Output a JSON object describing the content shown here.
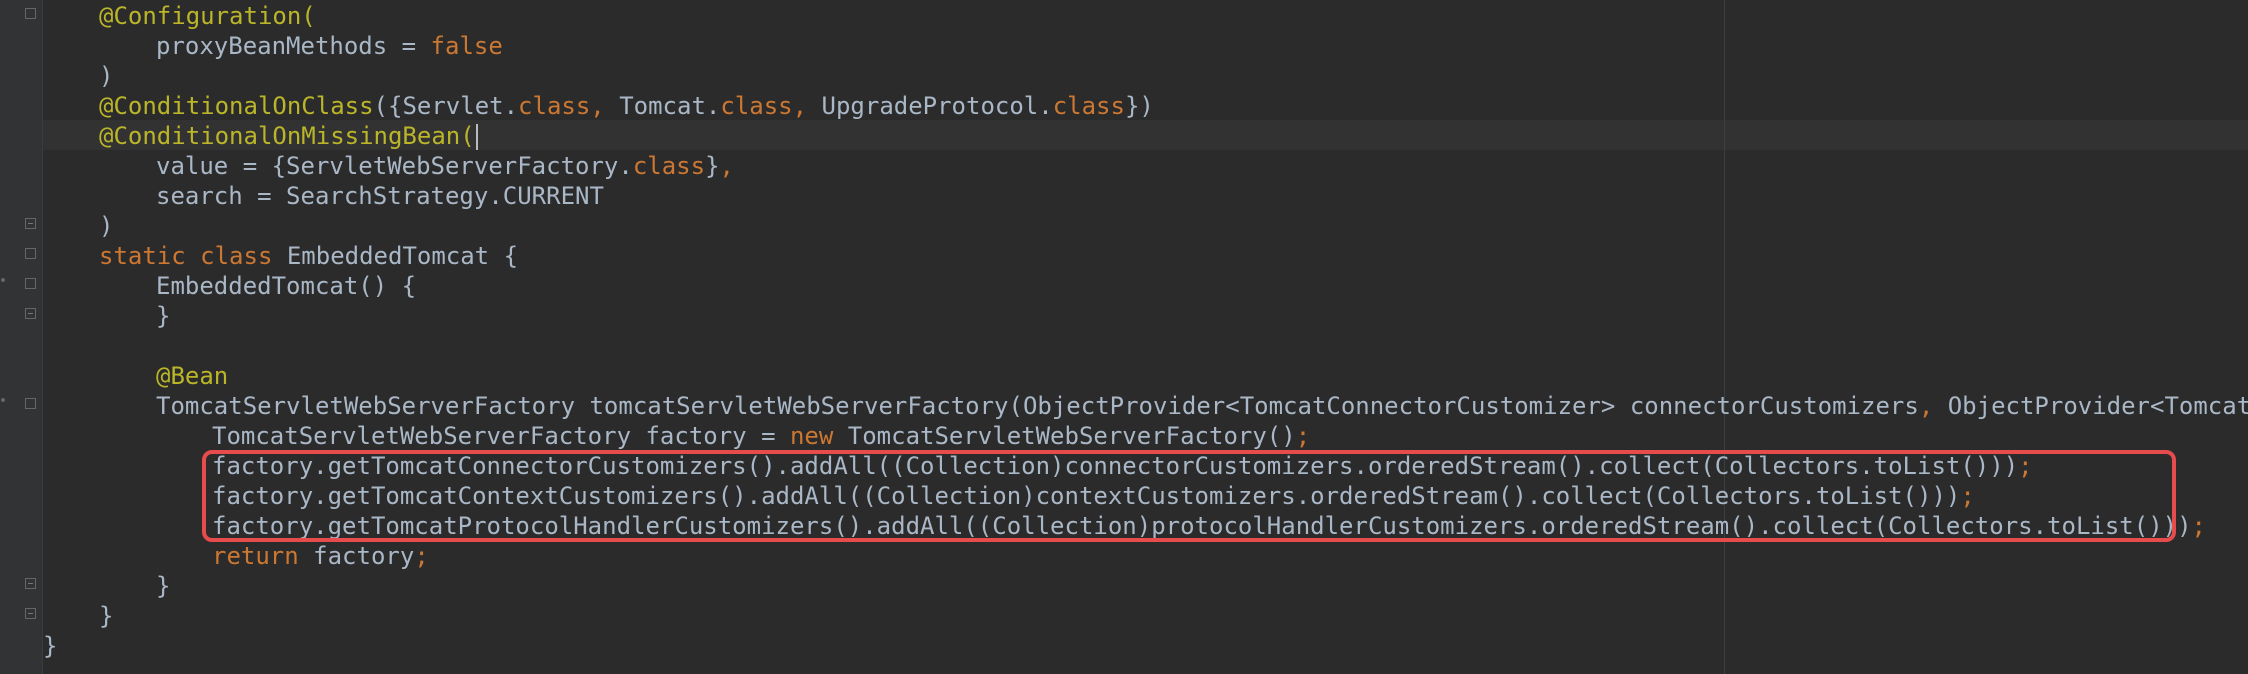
{
  "editor": {
    "lines": [
      {
        "left": [
          [
            "ann",
            "@Configuration("
          ]
        ]
      },
      {
        "left": [
          [
            "plain",
            "proxyBeanMethods = "
          ],
          [
            "kw",
            "false"
          ]
        ]
      },
      {
        "left": [
          [
            "plain",
            ")"
          ]
        ]
      },
      {
        "left": [
          [
            "ann",
            "@ConditionalOnClass"
          ],
          [
            "plain",
            "({Servlet."
          ],
          [
            "kw",
            "class"
          ],
          [
            "kw",
            ", "
          ],
          [
            "plain",
            "Tomcat."
          ],
          [
            "kw",
            "class"
          ],
          [
            "kw",
            ", "
          ],
          [
            "plain",
            "UpgradeProtocol."
          ],
          [
            "kw",
            "class"
          ],
          [
            "plain",
            "})"
          ]
        ]
      },
      {
        "left": [
          [
            "ann",
            "@ConditionalOnMissingBean("
          ]
        ]
      },
      {
        "left": [
          [
            "plain",
            "value = {ServletWebServerFactory."
          ],
          [
            "kw",
            "class"
          ],
          [
            "plain",
            "}"
          ],
          [
            "kw",
            ","
          ]
        ]
      },
      {
        "left": [
          [
            "plain",
            "search = SearchStrategy.CURRENT"
          ]
        ]
      },
      {
        "left": [
          [
            "plain",
            ")"
          ]
        ]
      },
      {
        "left": [
          [
            "kw",
            "static class "
          ],
          [
            "plain",
            "EmbeddedTomcat {"
          ]
        ]
      },
      {
        "left": [
          [
            "plain",
            "EmbeddedTomcat() {"
          ]
        ]
      },
      {
        "left": [
          [
            "plain",
            "}"
          ]
        ]
      },
      {
        "left": []
      },
      {
        "left": [
          [
            "ann",
            "@Bean"
          ]
        ]
      },
      {
        "left": [
          [
            "plain",
            "TomcatServletWebServerFactory tomcatServletWebServerFactory(ObjectProvider<TomcatConnectorCustomizer> connectorCustomizers"
          ],
          [
            "kw",
            ", "
          ],
          [
            "plain",
            "ObjectProvider<TomcatConte"
          ]
        ]
      },
      {
        "left": [
          [
            "plain",
            "TomcatServletWebServerFactory factory = "
          ],
          [
            "kw",
            "new "
          ],
          [
            "plain",
            "TomcatServletWebServerFactory()"
          ],
          [
            "kw",
            ";"
          ]
        ]
      },
      {
        "left": [
          [
            "plain",
            "factory.getTomcatConnectorCustomizers().addAll((Collection)connectorCustomizers.orderedStream().collect(Collectors.toList()))"
          ],
          [
            "kw",
            ";"
          ]
        ]
      },
      {
        "left": [
          [
            "plain",
            "factory.getTomcatContextCustomizers().addAll((Collection)contextCustomizers.orderedStream().collect(Collectors.toList()))"
          ],
          [
            "kw",
            ";"
          ]
        ]
      },
      {
        "left": [
          [
            "plain",
            "factory.getTomcatProtocolHandlerCustomizers().addAll((Collection)protocolHandlerCustomizers.orderedStream().collect(Collectors.toList()))"
          ],
          [
            "kw",
            ";"
          ]
        ]
      },
      {
        "left": [
          [
            "kw",
            "return "
          ],
          [
            "plain",
            "factory"
          ],
          [
            "kw",
            ";"
          ]
        ]
      },
      {
        "left": [
          [
            "plain",
            "}"
          ]
        ]
      },
      {
        "left": [
          [
            "plain",
            "}"
          ]
        ]
      },
      {
        "left": [
          [
            "plain",
            "}"
          ]
        ]
      }
    ],
    "colors": {
      "background": "#2b2b2b",
      "annotation": "#bbb529",
      "keyword": "#cc7832",
      "text": "#a9b7c6",
      "highlight_border": "#e74c4c"
    }
  }
}
